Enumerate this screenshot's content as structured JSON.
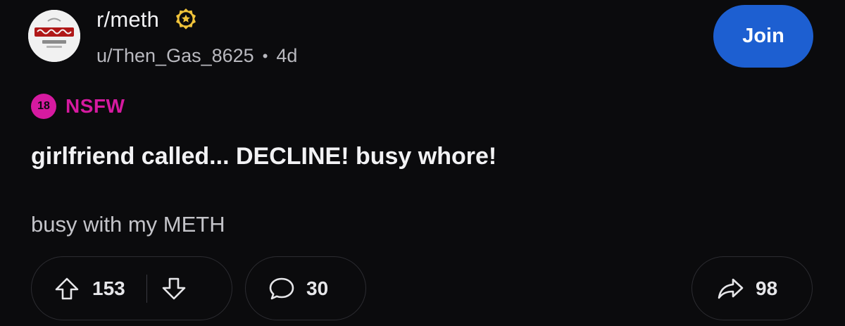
{
  "post": {
    "subreddit": "r/meth",
    "author": "u/Then_Gas_8625",
    "separator": "•",
    "age": "4d",
    "join_label": "Join",
    "nsfw": {
      "badge": "18",
      "label": "NSFW"
    },
    "title": "girlfriend called... DECLINE! busy whore!",
    "body": "busy with my METH"
  },
  "actions": {
    "upvotes": "153",
    "comments": "30",
    "shares": "98"
  },
  "icons": {
    "avatar": "subreddit-avatar-icon",
    "badge": "star-badge-icon",
    "upvote": "arrow-up-icon",
    "downvote": "arrow-down-icon",
    "comment": "speech-bubble-icon",
    "share": "share-arrow-icon"
  },
  "colors": {
    "background": "#0b0b0d",
    "join_button": "#1d5fd1",
    "nsfw": "#d61aa0",
    "badge_gold": "#f0c33a"
  }
}
